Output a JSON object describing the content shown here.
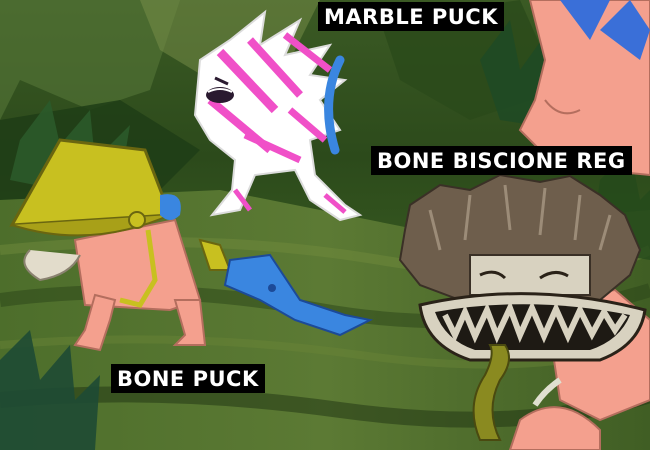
{
  "labels": {
    "marble_puck": "MARBLE PUCK",
    "bone_biscione": "BONE BISCIONE REG",
    "bone_puck": "BONE PUCK"
  },
  "colors": {
    "forest_dark": "#1c3512",
    "forest_mid": "#3f6a26",
    "marble_pink": "#f050c8",
    "bone_bell": "#c8c020",
    "blade_blue": "#3a86e0",
    "flesh_pink": "#f4a090",
    "hair_brown": "#6e5e4c",
    "label_bg": "#000000",
    "label_text": "#ffffff"
  }
}
